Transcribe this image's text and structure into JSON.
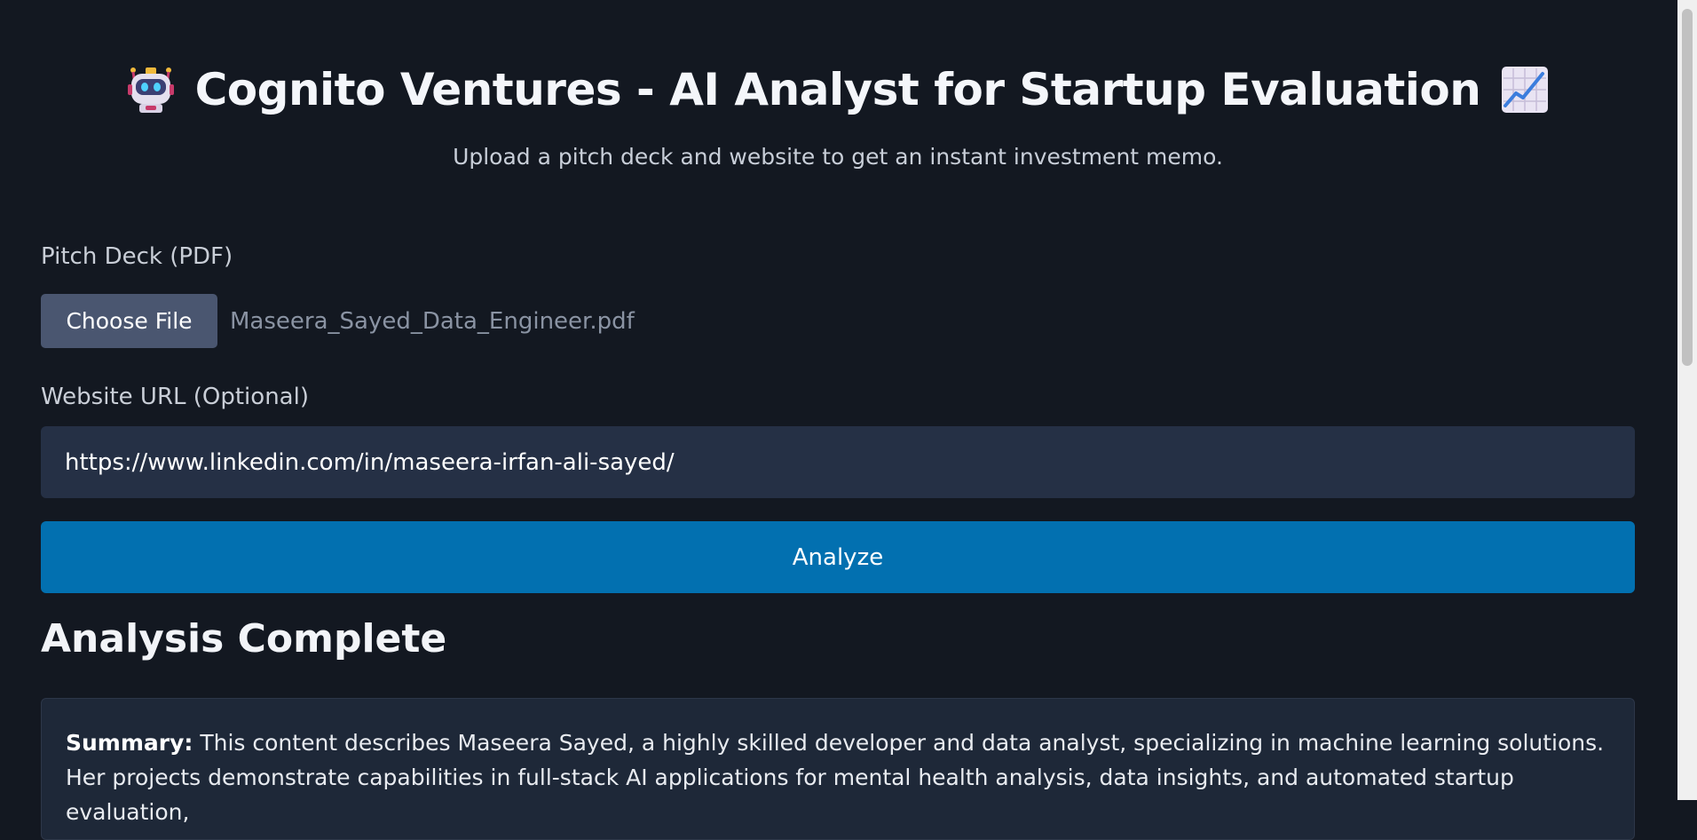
{
  "header": {
    "title": "Cognito Ventures - AI Analyst for Startup Evaluation",
    "subtitle": "Upload a pitch deck and website to get an instant investment memo.",
    "left_icon": "robot-icon",
    "right_icon": "chart-increasing-icon"
  },
  "form": {
    "pitch_label": "Pitch Deck (PDF)",
    "choose_file_label": "Choose File",
    "file_name": "Maseera_Sayed_Data_Engineer.pdf",
    "url_label": "Website URL (Optional)",
    "url_value": "https://www.linkedin.com/in/maseera-irfan-ali-sayed/",
    "analyze_label": "Analyze"
  },
  "results": {
    "title": "Analysis Complete",
    "summary_label": "Summary:",
    "summary_text": " This content describes Maseera Sayed, a highly skilled developer and data analyst, specializing in machine learning solutions. Her projects demonstrate capabilities in full-stack AI applications for mental health analysis, data insights, and automated startup evaluation,"
  },
  "colors": {
    "background": "#131821",
    "accent": "#0270b0",
    "input_bg": "#253045",
    "button_secondary": "#4a5670"
  }
}
